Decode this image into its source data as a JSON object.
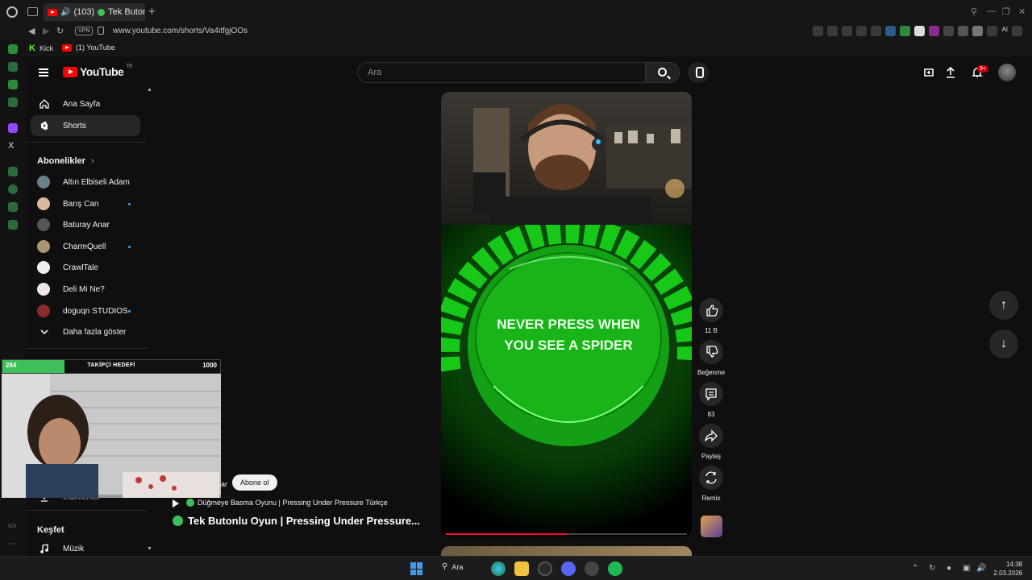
{
  "browser": {
    "tab": {
      "count": "(103)",
      "title": "Tek Butonlu O"
    },
    "url": "www.youtube.com/shorts/Va4itfgjOOs",
    "vpn": "VPN",
    "bookmarks": [
      {
        "label": "Kick",
        "icon": "kick-icon"
      },
      {
        "label": "(1) YouTube",
        "icon": "youtube-icon"
      }
    ],
    "extension_ai": "AI"
  },
  "header": {
    "logo": "YouTube",
    "region": "TR",
    "search_placeholder": "Ara",
    "notifications_badge": "9+"
  },
  "sidebar": {
    "home": "Ana Sayfa",
    "shorts": "Shorts",
    "subscriptions_heading": "Abonelikler",
    "subscriptions": [
      {
        "name": "Altın Elbiseli Adam",
        "new": false
      },
      {
        "name": "Barış Can",
        "new": true
      },
      {
        "name": "Baturay Anar",
        "new": false
      },
      {
        "name": "CharmQuell",
        "new": true
      },
      {
        "name": "CrawlTale",
        "new": false
      },
      {
        "name": "Deli Mi Ne?",
        "new": false
      },
      {
        "name": "doguqn STUDIOS",
        "new": true
      }
    ],
    "show_more": "Daha fazla göster",
    "partial_item": "İndirilenler",
    "explore_heading": "Keşfet",
    "music": "Müzik"
  },
  "stream_overlay": {
    "goal_label": "TAKİPÇİ HEDEFİ",
    "current": "284",
    "target": "1000",
    "progress": 0.284
  },
  "short": {
    "game_text_line1": "NEVER PRESS WHEN",
    "game_text_line2": "YOU SEE A SPIDER",
    "progress": 0.5,
    "channel_name_fragment": "ar",
    "subscribe_label": "Abone ol",
    "playlist_title": "Düğmeye Basma Oyunu | Pressing Under Pressure Türkçe",
    "title": "Tek Butonlu Oyun | Pressing Under Pressure..."
  },
  "actions": {
    "like_count": "11 B",
    "dislike_label": "Beğenme",
    "comment_count": "83",
    "share_label": "Paylaş",
    "remix_label": "Remix"
  },
  "taskbar": {
    "search_label": "Ara",
    "time": "14:38",
    "date": "2.03.2026"
  },
  "colors": {
    "background": "#0f0f0f",
    "youtube_red": "#ff0000",
    "game_green": "#18c818",
    "goal_green": "#3fbf5a",
    "new_dot": "#3ea6ff"
  }
}
